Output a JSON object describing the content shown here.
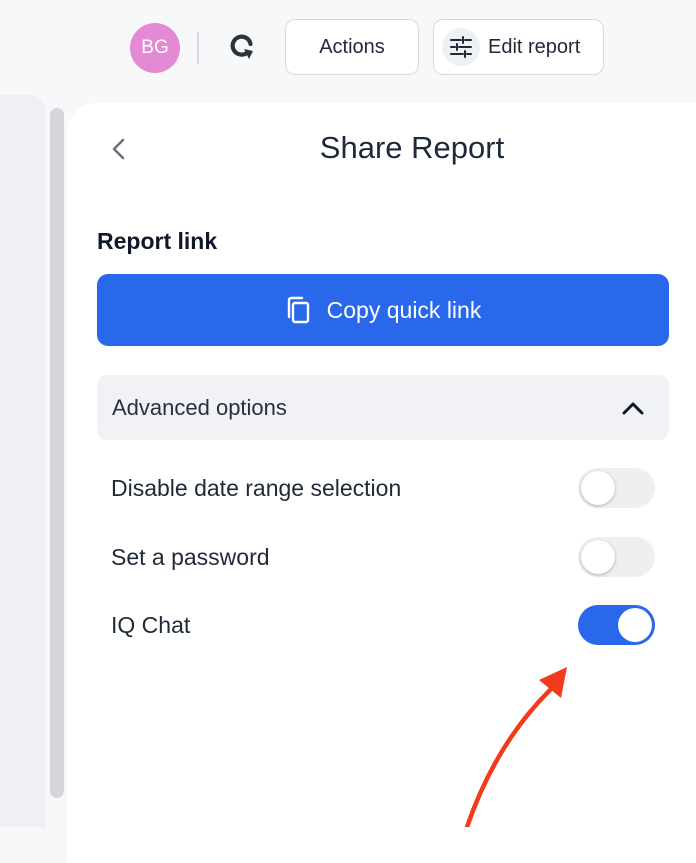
{
  "topbar": {
    "avatar_initials": "BG",
    "refresh_icon": "refresh-icon",
    "actions_label": "Actions",
    "edit_label": "Edit report",
    "edit_icon": "sliders-icon"
  },
  "panel": {
    "back_icon": "chevron-left-icon",
    "title": "Share Report",
    "report_link_label": "Report link",
    "copy_button_label": "Copy quick link",
    "copy_icon": "copy-icon",
    "advanced_label": "Advanced options",
    "advanced_expanded": true,
    "options": [
      {
        "label": "Disable date range selection",
        "enabled": false
      },
      {
        "label": "Set a password",
        "enabled": false
      },
      {
        "label": "IQ Chat",
        "enabled": true
      }
    ]
  },
  "colors": {
    "primary": "#2968ea",
    "avatar": "#e48ad4",
    "annotation_arrow": "#f23a1d"
  }
}
